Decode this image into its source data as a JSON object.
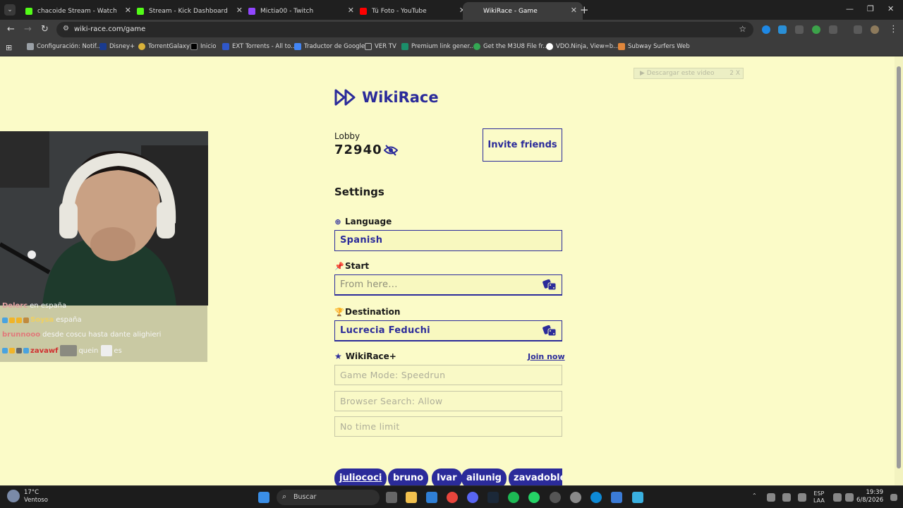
{
  "browser": {
    "tabs": [
      {
        "title": "chacoide Stream - Watch Live o",
        "color": "#53fc18"
      },
      {
        "title": "Stream - Kick Dashboard",
        "color": "#53fc18"
      },
      {
        "title": "Mictia00 - Twitch",
        "color": "#9146ff"
      },
      {
        "title": "Tú Foto - YouTube",
        "color": "#ff0000"
      },
      {
        "title": "WikiRace - Game",
        "color": "#2b2b9a"
      }
    ],
    "new_tab": "+",
    "url": "wiki-race.com/game",
    "bookmarks": [
      {
        "label": "Configuración: Notif...",
        "color": "#9aa0a6"
      },
      {
        "label": "Disney+",
        "color": "#1a3b8f"
      },
      {
        "label": "TorrentGalaxy",
        "color": "#d9b23a"
      },
      {
        "label": "Inicio",
        "color": "#000000"
      },
      {
        "label": "EXT Torrents - All to...",
        "color": "#2f57c9"
      },
      {
        "label": "Traductor de Google",
        "color": "#4285f4"
      },
      {
        "label": "VER TV",
        "color": "#9aa0a6"
      },
      {
        "label": "Premium link gener...",
        "color": "#1b8f6a"
      },
      {
        "label": "Get the M3U8 File fr...",
        "color": "#34a853"
      },
      {
        "label": "VDO.Ninja, View=b...",
        "color": "#ffffff"
      },
      {
        "label": "Subway Surfers Web",
        "color": "#e0863b"
      }
    ]
  },
  "page": {
    "download_button": "▶ Descargar este video",
    "download_badge": "2",
    "download_close": "X",
    "logo_text": "WikiRace",
    "lobby_label": "Lobby",
    "lobby_code": "72940",
    "invite_button": "Invite friends",
    "settings_title": "Settings",
    "language": {
      "label": "Language",
      "value": "Spanish"
    },
    "start": {
      "label": "Start",
      "placeholder": "From here..."
    },
    "destination": {
      "label": "Destination",
      "value": "Lucrecia Feduchi"
    },
    "wikirace_plus": {
      "label": "WikiRace+",
      "join": "Join now"
    },
    "options": [
      "Game Mode: Speedrun",
      "Browser Search: Allow",
      "No time limit"
    ],
    "players": [
      "juliococi",
      "bruno",
      "Ivar",
      "ailunig",
      "zavadoble"
    ]
  },
  "stream_overlay": {
    "chat": [
      {
        "user": "Delerc",
        "text": "en españa"
      },
      {
        "user": "Soysa",
        "text": "españa"
      },
      {
        "user": "brunnooo",
        "text": "desde coscu hasta dante alighieri"
      },
      {
        "user": "zavawf",
        "text": "quein",
        "extra": "es"
      }
    ]
  },
  "taskbar": {
    "weather_temp": "17°C",
    "weather_desc": "Ventoso",
    "search_placeholder": "Buscar",
    "lang_top": "ESP",
    "lang_bottom": "LAA",
    "time": "19:39",
    "date": "6/8/2026"
  }
}
